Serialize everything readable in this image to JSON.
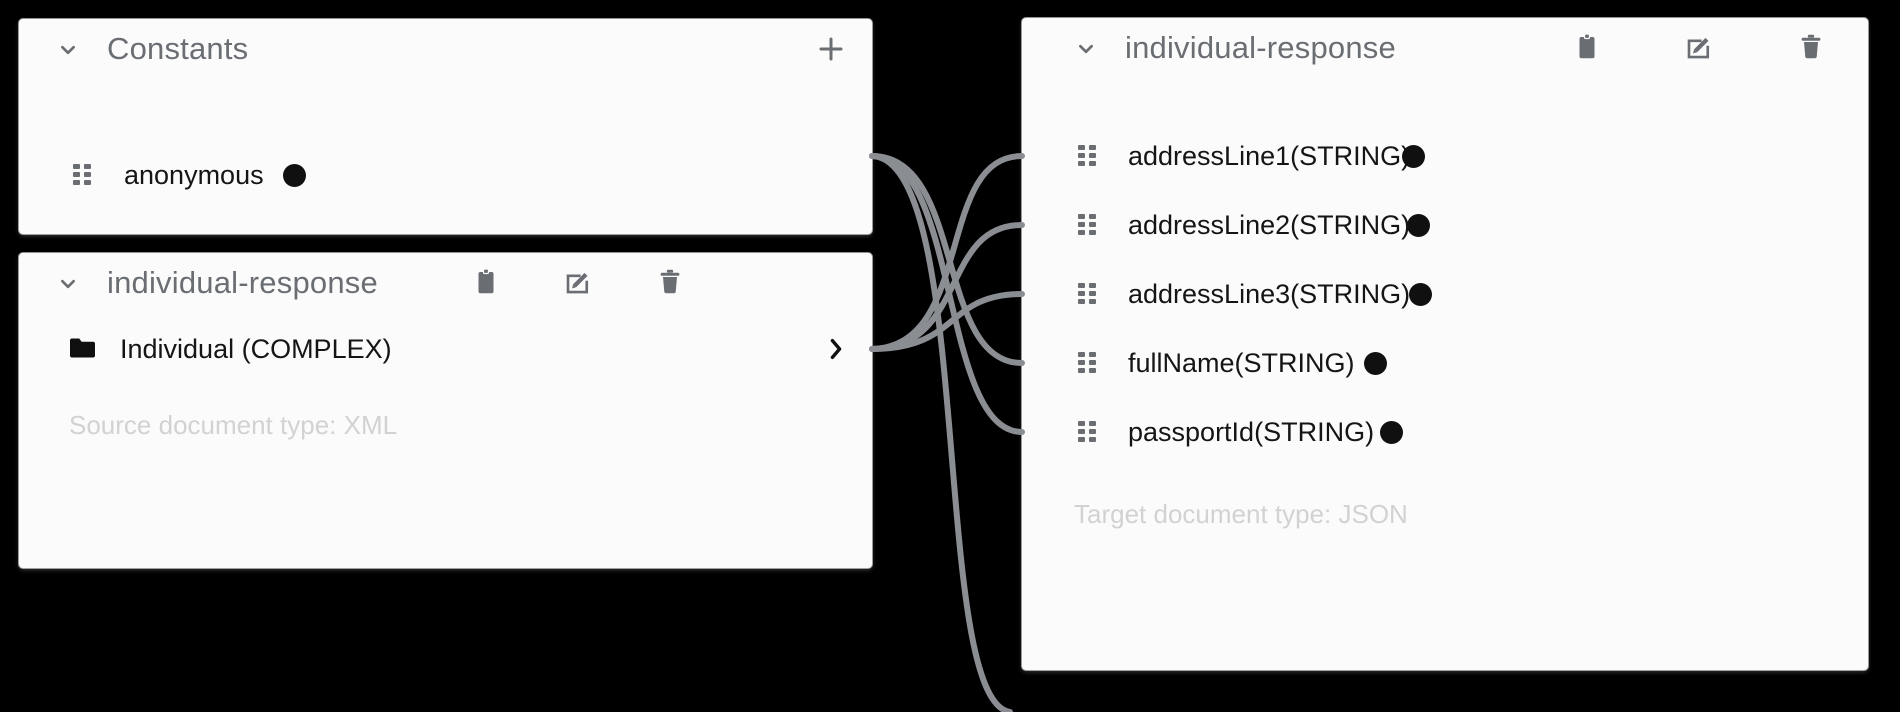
{
  "canvas": {
    "background_color": "#000000",
    "panel_background_color": "#fbfbfb",
    "link_color": "#8a8d91",
    "muted_text_color": "#6a6e73",
    "footnote_color": "#d2d2d2",
    "dot_color": "#101010"
  },
  "constants_panel": {
    "title": "Constants",
    "collapse_icon": "chevron-down-icon",
    "add_button": {
      "label": "+",
      "icon": "plus-icon"
    },
    "rows": [
      {
        "drag_icon": "drag-handle-icon",
        "label": "anonymous",
        "dot": "●"
      }
    ]
  },
  "source_panel": {
    "title": "individual-response",
    "collapse_icon": "chevron-down-icon",
    "actions": [
      {
        "name": "clipboard-icon",
        "tooltip": "Copy"
      },
      {
        "name": "edit-icon",
        "tooltip": "Edit"
      },
      {
        "name": "trash-icon",
        "tooltip": "Delete"
      }
    ],
    "rows": [
      {
        "folder_icon": "folder-icon",
        "label": "Individual (COMPLEX)",
        "expand_icon": "chevron-right-icon"
      }
    ],
    "footnote": "Source document type: XML"
  },
  "target_panel": {
    "title": "individual-response",
    "collapse_icon": "chevron-down-icon",
    "actions": [
      {
        "name": "clipboard-icon",
        "tooltip": "Copy"
      },
      {
        "name": "edit-icon",
        "tooltip": "Edit"
      },
      {
        "name": "trash-icon",
        "tooltip": "Delete"
      }
    ],
    "rows": [
      {
        "drag_icon": "drag-handle-icon",
        "label": "addressLine1(STRING)",
        "dot": "●"
      },
      {
        "drag_icon": "drag-handle-icon",
        "label": "addressLine2(STRING)",
        "dot": "●"
      },
      {
        "drag_icon": "drag-handle-icon",
        "label": "addressLine3(STRING)",
        "dot": "●"
      },
      {
        "drag_icon": "drag-handle-icon",
        "label": "fullName(STRING)",
        "dot": "●"
      },
      {
        "drag_icon": "drag-handle-icon",
        "label": "passportId(STRING)",
        "dot": "●"
      }
    ],
    "footnote": "Target document type: JSON"
  },
  "mapping_links": [
    {
      "from": "anonymous",
      "to": "addressLine1(STRING)"
    },
    {
      "from": "anonymous",
      "to": "fullName(STRING)"
    },
    {
      "from": "anonymous",
      "to": "passportId(STRING)"
    },
    {
      "from": "Individual (COMPLEX)",
      "to": "addressLine1(STRING)"
    },
    {
      "from": "Individual (COMPLEX)",
      "to": "addressLine2(STRING)"
    },
    {
      "from": "Individual (COMPLEX)",
      "to": "addressLine3(STRING)"
    }
  ]
}
